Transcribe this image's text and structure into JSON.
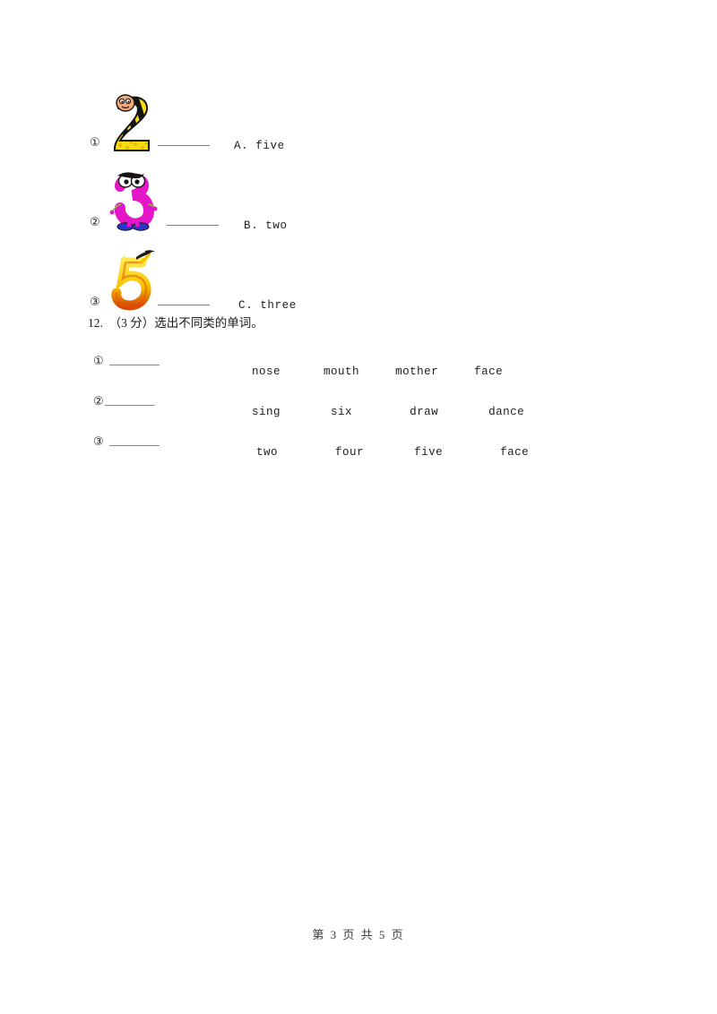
{
  "document": {
    "type": "worksheet-page",
    "background_color": "#ffffff",
    "text_color": "#1a1a1a"
  },
  "matching": {
    "rows": [
      {
        "marker": "①",
        "image": {
          "name": "cartoon-number-two",
          "digit": "2",
          "description": "striped caterpillar-style number two with a face",
          "colors": [
            "#f5d400",
            "#1a1a1a",
            "#f0a882"
          ]
        },
        "blank": "",
        "choice": "A. five"
      },
      {
        "marker": "②",
        "image": {
          "name": "cartoon-number-three",
          "digit": "3",
          "description": "magenta creature shaped like a number three with shoes",
          "colors": [
            "#e516c8",
            "#2626c8",
            "#ffffff"
          ]
        },
        "blank": "",
        "choice": "B. two"
      },
      {
        "marker": "③",
        "image": {
          "name": "cartoon-number-five",
          "digit": "5",
          "description": "flame styled number five with smoke wisp",
          "colors": [
            "#f5c400",
            "#e04800",
            "#1a1a1a"
          ]
        },
        "blank": "",
        "choice": "C. three"
      }
    ]
  },
  "question12": {
    "number": "12.",
    "score": "（3 分）",
    "prompt": "选出不同类的单词。",
    "heading_full": "12.  （3 分）选出不同类的单词。",
    "rows": [
      {
        "marker": "①",
        "answer": "",
        "options": [
          "nose",
          "mouth",
          "mother",
          "face"
        ]
      },
      {
        "marker": "②",
        "answer": "",
        "options": [
          "sing",
          "six",
          "draw",
          "dance"
        ]
      },
      {
        "marker": "③",
        "answer": "",
        "options": [
          "two",
          "four",
          "five",
          "face"
        ]
      }
    ]
  },
  "footer": {
    "text": "第 3 页 共 5 页",
    "current_page": "3",
    "total_pages": "5"
  }
}
